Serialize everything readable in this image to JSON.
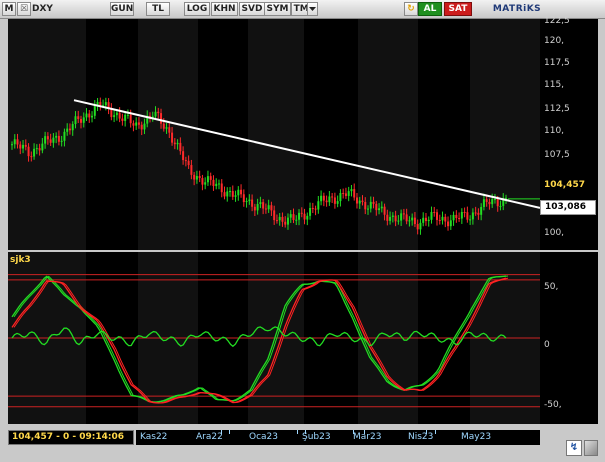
{
  "toolbar": {
    "m_label": "M",
    "close_label": "☒",
    "symbol": "DXY",
    "buttons": [
      "GUN",
      "TL",
      "LOG",
      "KHN",
      "SVD",
      "SYM",
      "TMP"
    ],
    "dropdown_icon": "chevron-down-icon",
    "refresh_icon": "refresh-icon",
    "lock_icon": "lock-icon",
    "buy_label": "AL",
    "sell_label": "SAT",
    "brand": "MATRiKS"
  },
  "colors": {
    "background": "#000000",
    "trendline": "#ffffff",
    "indicator_main": "#22dd22",
    "indicator_signal": "#ff2222",
    "level_lines": "#cc2222",
    "price_label": "#ffd84a"
  },
  "main_chart": {
    "y_labels": [
      "122,5",
      "120,",
      "117,5",
      "115,",
      "112,5",
      "110,",
      "107,5",
      "105,",
      "104,457",
      "103,086",
      "100,"
    ],
    "last_price": "104,457",
    "crosshair_price": "103,086"
  },
  "indicator": {
    "name": "sjk3",
    "labels": [
      "50,",
      "0",
      "-50,"
    ]
  },
  "x_axis": {
    "labels": [
      "Kas22",
      "Ara22",
      "Oca23",
      "Şub23",
      "Mar23",
      "Nis23",
      "May23"
    ]
  },
  "status": {
    "readout": "104,457 - 0 - 09:14:06",
    "help_icon": "help-icon"
  },
  "chart_data": [
    {
      "type": "candlestick",
      "title": "DXY",
      "ylim": [
        99,
        123
      ],
      "yticks": [
        100,
        105,
        107.5,
        110,
        112.5,
        115,
        117.5,
        120,
        122.5
      ],
      "x": [
        "Kas22",
        "Ara22",
        "Oca23",
        "Şub23",
        "Mar23",
        "Nis23",
        "May23"
      ],
      "close_approx": [
        110.3,
        109.5,
        110.5,
        111.5,
        113.2,
        114.5,
        113.5,
        112.2,
        113.5,
        111.5,
        107.5,
        106.3,
        105.5,
        104.5,
        103.8,
        102.5,
        102.1,
        103.5,
        104.5,
        105.0,
        104.0,
        103.0,
        102.3,
        102.0,
        102.5,
        102.2,
        102.8,
        104.0,
        104.5
      ],
      "last": 104.457,
      "crosshair": 103.086,
      "trendline": {
        "start": 115,
        "end": 103.5
      }
    },
    {
      "type": "line",
      "title": "sjk3",
      "ylim": [
        -70,
        70
      ],
      "levels": [
        60,
        55,
        0,
        -55,
        -65
      ],
      "labels": [
        "50,",
        "0",
        "-50,"
      ],
      "series": [
        {
          "values": [
            20,
            40,
            60,
            40,
            30,
            10,
            -20,
            -55,
            -60,
            -58,
            -55,
            -45,
            -60,
            -58,
            -50,
            -20,
            30,
            50,
            55,
            50,
            20,
            -20,
            -40,
            -50,
            -45,
            -30,
            0,
            30,
            55,
            60
          ]
        },
        {
          "values": [
            10,
            30,
            55,
            50,
            30,
            15,
            -10,
            -45,
            -60,
            -60,
            -57,
            -50,
            -55,
            -60,
            -55,
            -35,
            10,
            45,
            55,
            53,
            30,
            -10,
            -35,
            -50,
            -50,
            -35,
            -10,
            20,
            50,
            58
          ]
        },
        {
          "values": [
            0,
            5,
            -5,
            10,
            -5,
            5,
            0,
            -5,
            5,
            0,
            -5,
            5,
            0,
            -5,
            5,
            10,
            5,
            0,
            -5,
            5,
            0,
            -5,
            5,
            0,
            5,
            0,
            -5,
            5,
            0,
            0
          ]
        }
      ]
    }
  ]
}
